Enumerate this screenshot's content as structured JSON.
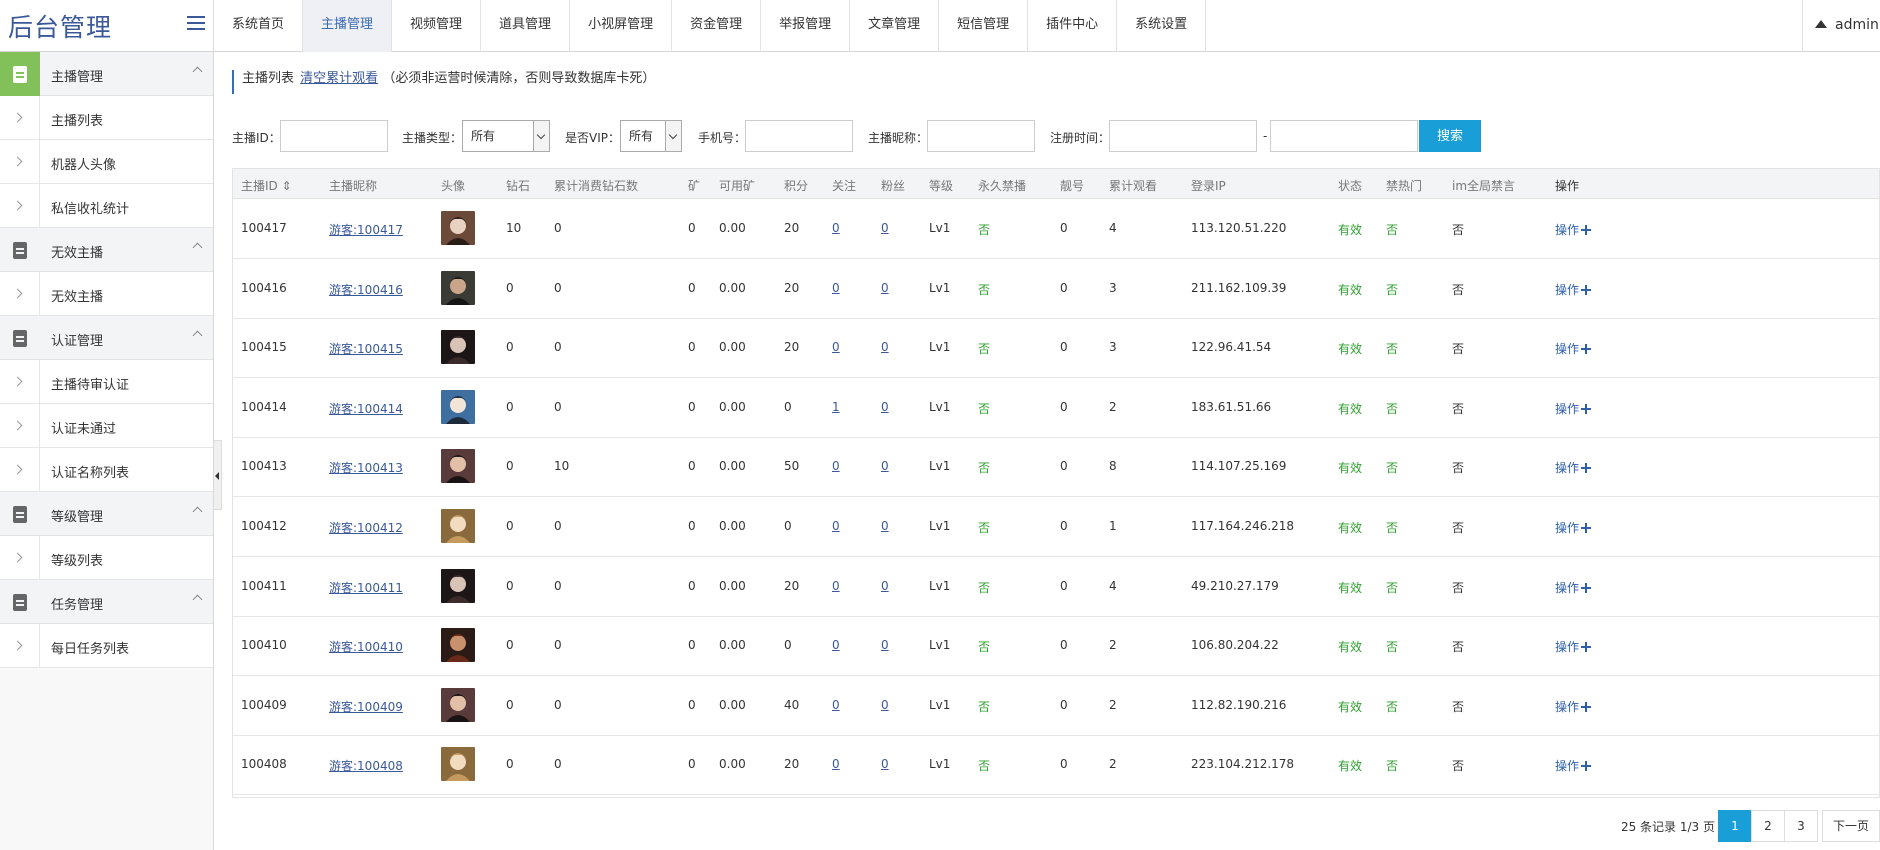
{
  "app": {
    "title": "后台管理"
  },
  "nav": {
    "tabs": [
      "系统首页",
      "主播管理",
      "视频管理",
      "道具管理",
      "小视屏管理",
      "资金管理",
      "举报管理",
      "文章管理",
      "短信管理",
      "插件中心",
      "系统设置"
    ],
    "active": 1
  },
  "user": {
    "name": "admin"
  },
  "sidebar": {
    "groups": [
      {
        "label": "主播管理",
        "open": true,
        "items": [
          "主播列表",
          "机器人头像",
          "私信收礼统计"
        ]
      },
      {
        "label": "无效主播",
        "open": false,
        "items": [
          "无效主播"
        ]
      },
      {
        "label": "认证管理",
        "open": false,
        "items": [
          "主播待审认证",
          "认证未通过",
          "认证名称列表"
        ]
      },
      {
        "label": "等级管理",
        "open": false,
        "items": [
          "等级列表"
        ]
      },
      {
        "label": "任务管理",
        "open": false,
        "items": [
          "每日任务列表"
        ]
      }
    ]
  },
  "breadcrumb": {
    "title": "主播列表",
    "clear_link": "清空累计观看",
    "note": "（必须非运营时候清除，否则导致数据库卡死）"
  },
  "filters": {
    "anchor_id_label": "主播ID：",
    "anchor_id_value": "",
    "type_label": "主播类型：",
    "type_value": "所有",
    "vip_label": "是否VIP：",
    "vip_value": "所有",
    "phone_label": "手机号：",
    "phone_value": "",
    "nickname_label": "主播昵称：",
    "nickname_value": "",
    "regtime_label": "注册时间：",
    "regtime_from": "",
    "regtime_sep": "-",
    "regtime_to": "",
    "search_label": "搜索"
  },
  "table": {
    "headers": [
      "主播ID ⇕",
      "主播昵称",
      "头像",
      "钻石",
      "累计消费钻石数",
      "矿",
      "可用矿",
      "积分",
      "关注",
      "粉丝",
      "等级",
      "永久禁播",
      "靓号",
      "累计观看",
      "登录IP",
      "状态",
      "禁热门",
      "im全局禁言",
      "操作"
    ],
    "rows": [
      {
        "id": "100417",
        "nick": "游客:100417",
        "diamond": "10",
        "spent": "0",
        "mine": "0",
        "avail": "0.00",
        "score": "20",
        "follow": "0",
        "fans": "0",
        "level": "Lv1",
        "ban": "否",
        "pretty": "0",
        "views": "4",
        "ip": "113.120.51.220",
        "status": "有效",
        "hot": "否",
        "im": "否",
        "op": "操作"
      },
      {
        "id": "100416",
        "nick": "游客:100416",
        "diamond": "0",
        "spent": "0",
        "mine": "0",
        "avail": "0.00",
        "score": "20",
        "follow": "0",
        "fans": "0",
        "level": "Lv1",
        "ban": "否",
        "pretty": "0",
        "views": "3",
        "ip": "211.162.109.39",
        "status": "有效",
        "hot": "否",
        "im": "否",
        "op": "操作"
      },
      {
        "id": "100415",
        "nick": "游客:100415",
        "diamond": "0",
        "spent": "0",
        "mine": "0",
        "avail": "0.00",
        "score": "20",
        "follow": "0",
        "fans": "0",
        "level": "Lv1",
        "ban": "否",
        "pretty": "0",
        "views": "3",
        "ip": "122.96.41.54",
        "status": "有效",
        "hot": "否",
        "im": "否",
        "op": "操作"
      },
      {
        "id": "100414",
        "nick": "游客:100414",
        "diamond": "0",
        "spent": "0",
        "mine": "0",
        "avail": "0.00",
        "score": "0",
        "follow": "1",
        "fans": "0",
        "level": "Lv1",
        "ban": "否",
        "pretty": "0",
        "views": "2",
        "ip": "183.61.51.66",
        "status": "有效",
        "hot": "否",
        "im": "否",
        "op": "操作"
      },
      {
        "id": "100413",
        "nick": "游客:100413",
        "diamond": "0",
        "spent": "10",
        "mine": "0",
        "avail": "0.00",
        "score": "50",
        "follow": "0",
        "fans": "0",
        "level": "Lv1",
        "ban": "否",
        "pretty": "0",
        "views": "8",
        "ip": "114.107.25.169",
        "status": "有效",
        "hot": "否",
        "im": "否",
        "op": "操作"
      },
      {
        "id": "100412",
        "nick": "游客:100412",
        "diamond": "0",
        "spent": "0",
        "mine": "0",
        "avail": "0.00",
        "score": "0",
        "follow": "0",
        "fans": "0",
        "level": "Lv1",
        "ban": "否",
        "pretty": "0",
        "views": "1",
        "ip": "117.164.246.218",
        "status": "有效",
        "hot": "否",
        "im": "否",
        "op": "操作"
      },
      {
        "id": "100411",
        "nick": "游客:100411",
        "diamond": "0",
        "spent": "0",
        "mine": "0",
        "avail": "0.00",
        "score": "20",
        "follow": "0",
        "fans": "0",
        "level": "Lv1",
        "ban": "否",
        "pretty": "0",
        "views": "4",
        "ip": "49.210.27.179",
        "status": "有效",
        "hot": "否",
        "im": "否",
        "op": "操作"
      },
      {
        "id": "100410",
        "nick": "游客:100410",
        "diamond": "0",
        "spent": "0",
        "mine": "0",
        "avail": "0.00",
        "score": "0",
        "follow": "0",
        "fans": "0",
        "level": "Lv1",
        "ban": "否",
        "pretty": "0",
        "views": "2",
        "ip": "106.80.204.22",
        "status": "有效",
        "hot": "否",
        "im": "否",
        "op": "操作"
      },
      {
        "id": "100409",
        "nick": "游客:100409",
        "diamond": "0",
        "spent": "0",
        "mine": "0",
        "avail": "0.00",
        "score": "40",
        "follow": "0",
        "fans": "0",
        "level": "Lv1",
        "ban": "否",
        "pretty": "0",
        "views": "2",
        "ip": "112.82.190.216",
        "status": "有效",
        "hot": "否",
        "im": "否",
        "op": "操作"
      },
      {
        "id": "100408",
        "nick": "游客:100408",
        "diamond": "0",
        "spent": "0",
        "mine": "0",
        "avail": "0.00",
        "score": "20",
        "follow": "0",
        "fans": "0",
        "level": "Lv1",
        "ban": "否",
        "pretty": "0",
        "views": "2",
        "ip": "223.104.212.178",
        "status": "有效",
        "hot": "否",
        "im": "否",
        "op": "操作"
      }
    ]
  },
  "pager": {
    "info": "25 条记录 1/3 页",
    "pages": [
      "1",
      "2",
      "3"
    ],
    "current": "1",
    "next": "下一页"
  },
  "colors": {
    "brand": "#3b5998",
    "accent": "#1a9ed8",
    "sidebar_active": "#82c05a",
    "status_green": "#2ea02e"
  }
}
